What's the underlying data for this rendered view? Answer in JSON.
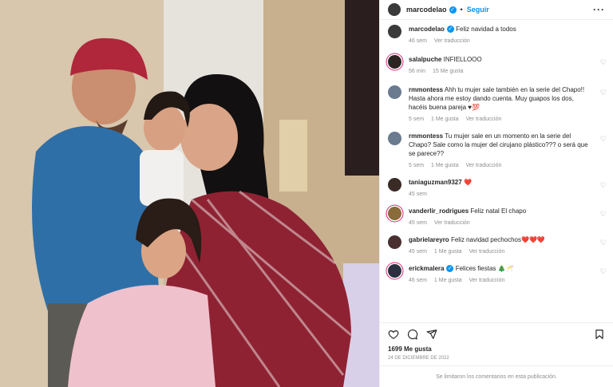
{
  "header": {
    "username": "marcodelao",
    "dot": "•",
    "follow_label": "Seguir",
    "more_label": "···"
  },
  "caption": {
    "username": "marcodelao",
    "text": "Feliz navidad a todos",
    "meta_time": "46 sem",
    "meta_translate": "Ver traducción"
  },
  "comments": [
    {
      "user": "salalpuche",
      "text": "INFIELLOOO",
      "time": "56 min",
      "likes": "15 Me gusta",
      "translate": "",
      "avatar_color": "#2d2320"
    },
    {
      "user": "rmmontess",
      "text": "Ahh tu mujer sale también en la serie del Chapo!! Hasta ahora me estoy dando cuenta. Muy guapos los dos, hacéis buena pareja ♥💯",
      "time": "5 sem",
      "likes": "1 Me gusta",
      "translate": "Ver traducción",
      "avatar_color": "#6a7b8f"
    },
    {
      "user": "rmmontess",
      "text": "Tu mujer sale en un momento en la serie del Chapo? Sale como la mujer del cirujano plástico??? o será que se parece??",
      "time": "5 sem",
      "likes": "1 Me gusta",
      "translate": "Ver traducción",
      "avatar_color": "#6a7b8f"
    },
    {
      "user": "taniaguzman9327",
      "text": "❤️",
      "time": "45 sem",
      "likes": "",
      "translate": "",
      "avatar_color": "#3b2b26"
    },
    {
      "user": "vanderlir_rodrigues",
      "text": "Feliz natal El chapo",
      "time": "45 sem",
      "likes": "",
      "translate": "Ver traducción",
      "avatar_color": "#8a6b3a"
    },
    {
      "user": "gabrielareyro",
      "text": "Feliz navidad pechochos❤️❤️❤️",
      "time": "45 sem",
      "likes": "1 Me gusta",
      "translate": "Ver traducción",
      "avatar_color": "#4a3030"
    },
    {
      "user": "erickmalera",
      "text": "Felices fiestas 🎄🥂",
      "time": "46 sem",
      "likes": "1 Me gusta",
      "translate": "Ver traducción",
      "avatar_color": "#2b3040",
      "verified": true
    }
  ],
  "actions": {
    "heart_icon": "heart-icon",
    "comment_icon": "comment-icon",
    "share_icon": "share-icon",
    "save_icon": "bookmark-icon"
  },
  "likes_count": "1699 Me gusta",
  "post_date": "24 de diciembre de 2022",
  "comments_limited_notice": "Se limitaron los comentarios en esta publicación.",
  "colors": {
    "accent": "#0095f6",
    "muted": "#8e8e8e",
    "like_red": "#ed4956"
  }
}
